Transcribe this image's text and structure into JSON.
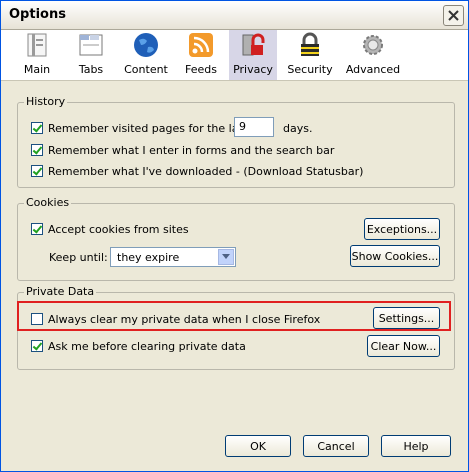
{
  "window": {
    "title": "Options"
  },
  "tabs": [
    {
      "label": "Main",
      "icon": "main-icon"
    },
    {
      "label": "Tabs",
      "icon": "tabs-icon"
    },
    {
      "label": "Content",
      "icon": "content-globe-icon"
    },
    {
      "label": "Feeds",
      "icon": "feeds-icon"
    },
    {
      "label": "Privacy",
      "icon": "privacy-lock-icon",
      "active": true
    },
    {
      "label": "Security",
      "icon": "security-padlock-icon"
    },
    {
      "label": "Advanced",
      "icon": "advanced-gear-icon"
    }
  ],
  "history": {
    "title": "History",
    "remember_visited_prefix": "Remember visited pages for the last",
    "days_value": "9",
    "days_suffix": "days.",
    "remember_forms": "Remember what I enter in forms and the search bar",
    "remember_downloads": "Remember what I've downloaded - (Download Statusbar)"
  },
  "cookies": {
    "title": "Cookies",
    "accept": "Accept cookies from sites",
    "exceptions_button": "Exceptions...",
    "keep_until_label": "Keep until:",
    "keep_until_value": "they expire",
    "show_cookies_button": "Show Cookies..."
  },
  "private_data": {
    "title": "Private Data",
    "always_clear": "Always clear my private data when I close Firefox",
    "always_clear_checked": false,
    "settings_button": "Settings...",
    "ask_before": "Ask me before clearing private data",
    "ask_before_checked": true,
    "clear_now_button": "Clear Now..."
  },
  "footer": {
    "ok": "OK",
    "cancel": "Cancel",
    "help": "Help"
  },
  "colors": {
    "highlight": "#e02020",
    "active_tab": "#d7d6e7",
    "dialog_bg": "#ece9d8"
  }
}
